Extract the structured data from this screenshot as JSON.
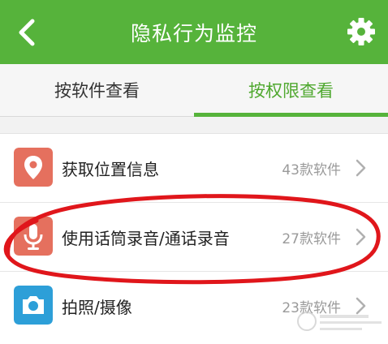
{
  "header": {
    "title": "隐私行为监控",
    "back_icon": "back-arrow-icon",
    "settings_icon": "gear-icon",
    "bg_color": "#56b33b"
  },
  "tabs": [
    {
      "label": "按软件查看",
      "active": false
    },
    {
      "label": "按权限查看",
      "active": true
    }
  ],
  "accent_color": "#56b33b",
  "permissions": [
    {
      "label": "获取位置信息",
      "count": "43款软件",
      "icon": "location-pin-icon",
      "icon_color": "#e5705e"
    },
    {
      "label": "使用话筒录音/通话录音",
      "count": "27款软件",
      "icon": "microphone-icon",
      "icon_color": "#e5705e"
    },
    {
      "label": "拍照/摄像",
      "count": "23款软件",
      "icon": "camera-icon",
      "icon_color": "#2d9fd8"
    }
  ]
}
